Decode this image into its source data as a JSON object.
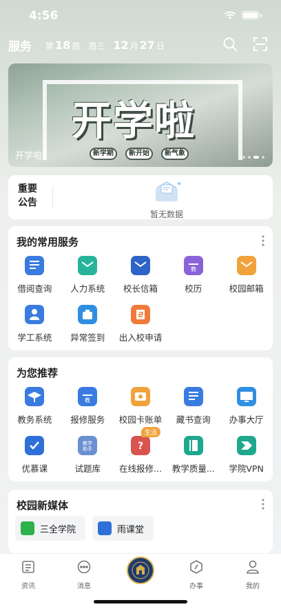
{
  "status": {
    "time": "4:56"
  },
  "header": {
    "title": "服务",
    "week_prefix": "第",
    "week_num": "18",
    "week_suffix": "周",
    "weekday": "周三",
    "month": "12",
    "month_unit": "月",
    "day": "27",
    "day_unit": "日"
  },
  "banner": {
    "headline": "开学啦",
    "pills": [
      "新学期",
      "新开始",
      "新气象"
    ],
    "caption": "开学啦！",
    "slide_count": 4,
    "active_slide": 3
  },
  "notice": {
    "label": "重要公告",
    "empty_text": "暂无数据"
  },
  "services": {
    "title": "我的常用服务",
    "items": [
      {
        "label": "借阅查询",
        "icon": "borrow-query-icon",
        "color": "#3a7be0"
      },
      {
        "label": "人力系统",
        "icon": "hr-system-icon",
        "color": "#27b39a"
      },
      {
        "label": "校长信箱",
        "icon": "principal-mailbox-icon",
        "color": "#2e63c8"
      },
      {
        "label": "校历",
        "icon": "calendar-icon",
        "color": "#8a63d8"
      },
      {
        "label": "校园邮箱",
        "icon": "campus-mail-icon",
        "color": "#f2a23c"
      },
      {
        "label": "学工系统",
        "icon": "student-affairs-icon",
        "color": "#3a7be0"
      },
      {
        "label": "异常签到",
        "icon": "abnormal-checkin-icon",
        "color": "#2f8fe0"
      },
      {
        "label": "出入校申请",
        "icon": "campus-access-icon",
        "color": "#f07a3a"
      }
    ]
  },
  "recommend": {
    "title": "为您推荐",
    "items": [
      {
        "label": "教务系统",
        "icon": "academic-system-icon",
        "color": "#3a7be0"
      },
      {
        "label": "报修服务",
        "icon": "repair-service-icon",
        "color": "#3a7be0"
      },
      {
        "label": "校园卡账单",
        "icon": "campus-card-bill-icon",
        "color": "#f2a23c"
      },
      {
        "label": "藏书查询",
        "icon": "book-search-icon",
        "color": "#3a7be0"
      },
      {
        "label": "办事大厅",
        "icon": "service-hall-icon",
        "color": "#2f8fe0"
      },
      {
        "label": "优慕课",
        "icon": "umooc-icon",
        "color": "#2f6fd8"
      },
      {
        "label": "试题库",
        "icon": "question-bank-icon",
        "color": "#6b8fd0"
      },
      {
        "label": "在线报修...",
        "icon": "online-repair-icon",
        "color": "#d9534f",
        "badge": "生活"
      },
      {
        "label": "教学质量...",
        "icon": "teaching-quality-icon",
        "color": "#1fa88e"
      },
      {
        "label": "学院VPN",
        "icon": "vpn-icon",
        "color": "#1fa88e"
      }
    ]
  },
  "media": {
    "title": "校园新媒体",
    "items": [
      {
        "label": "三全学院",
        "icon": "wechat-icon",
        "color": "#2bb24c"
      },
      {
        "label": "雨课堂",
        "icon": "rain-classroom-icon",
        "color": "#2f6fd8"
      }
    ]
  },
  "tabbar": {
    "items": [
      {
        "label": "资讯",
        "icon": "news-icon"
      },
      {
        "label": "消息",
        "icon": "message-icon"
      },
      {
        "label": "",
        "icon": "school-emblem-icon"
      },
      {
        "label": "办事",
        "icon": "affairs-icon"
      },
      {
        "label": "我的",
        "icon": "profile-icon"
      }
    ]
  }
}
